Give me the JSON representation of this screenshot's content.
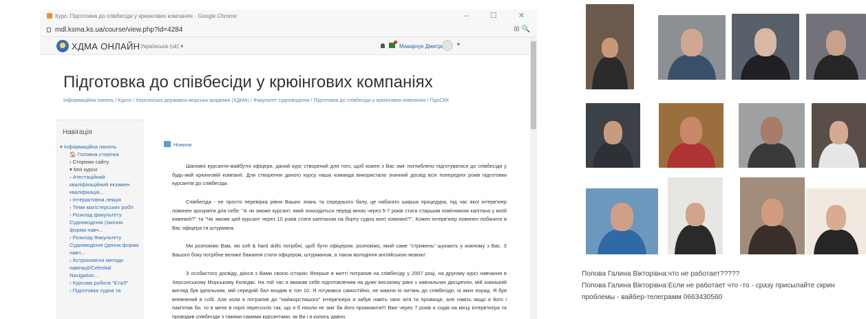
{
  "browser": {
    "window_title": "Курс: Підготовка до співбесіди у крюінгових компаніях - Google Chrome",
    "url": "mdl.ksma.ks.ua/course/view.php?id=4284",
    "window_controls": "–  ☐  ✕",
    "url_right_icons": "⊞  🔍"
  },
  "site": {
    "name": "ХДМА ОНЛАЙН",
    "language": "Українська (uk) ▾",
    "user": "Макарчук Дмитро",
    "user_menu": "▾"
  },
  "page": {
    "title": "Підготовка до співбесіди у крюінгових компаніях",
    "breadcrumb": "Інформаційна панель / Курси / Херсонська державна морська академія (ХДМА) / Факультет судноводіння / Підготовка до співбесіди у крюінгових компаніях / ПдоСКК"
  },
  "sidebar": {
    "heading": "Навігація",
    "items": [
      {
        "label": "▾ Інформаційна панель",
        "cls": ""
      },
      {
        "label": "🏠 Головна сторінка",
        "cls": "sub"
      },
      {
        "label": "› Сторінки сайту",
        "cls": "sub dark"
      },
      {
        "label": "▾ Мої курси",
        "cls": "sub dark"
      },
      {
        "label": "› Атестаційний",
        "cls": "sub"
      },
      {
        "label": "кваліфікаційний екзамен",
        "cls": "sub"
      },
      {
        "label": "кваліфікація...",
        "cls": "sub"
      },
      {
        "label": "› Інтерактивна лекція",
        "cls": "sub"
      },
      {
        "label": "› Теми магістерських робіт",
        "cls": "sub"
      },
      {
        "label": "› Розклад факультету",
        "cls": "sub"
      },
      {
        "label": "Судноводіння (заочна",
        "cls": "sub"
      },
      {
        "label": "форма навч...",
        "cls": "sub"
      },
      {
        "label": "› Розклад Факультету",
        "cls": "sub"
      },
      {
        "label": "Судноводіння (денна форма",
        "cls": "sub"
      },
      {
        "label": "навч...",
        "cls": "sub"
      },
      {
        "label": "› Астрономічні методи",
        "cls": "sub"
      },
      {
        "label": "навігації/Celestial",
        "cls": "sub"
      },
      {
        "label": "Navigation...",
        "cls": "sub"
      },
      {
        "label": "› Курсова робота \"ЄтаЛ\"",
        "cls": "sub"
      },
      {
        "label": "› Підготовка судна та",
        "cls": "sub"
      }
    ]
  },
  "content": {
    "news_label": "Новини",
    "paragraphs": [
      "Шановні курсанти-майбутні офіцери, даний курс створений для того, щоб кожен з Вас зміг поглиблено підготуватися до співбесіди у будь-якій крюінговій компанії. Для створення даного курсу наша команда використала значний досвід всіх попередніх років підготовки курсантів до співбесіди.",
      "Співбесіда - не просто перевірка рівня Ваших знань та середнього балу, це набагато ширша процедура, під час якої інтерв'юер повинен зрозуміти для себе: \"А чи зможе курсант, який знаходиться переді мною через 5-7 років стати старшим помічником капітана у моїй компанії?\" та \"Чи зможе цей курсант через 10 років стати капітаном на борту судна моєї компанії?\". Кожен інтерв'юер повинен побачити в Вас офіцера та штурмана.",
      "Ми розповімо Вам, які soft & hard skills потрібні, щоб бути офіцером, розповімо, який саме \"стрижень\" шукають у кожному з Вас. З Вашого боку потрібне велике бажання стати офіцером, штурманом, а також володіння англійською мовою!",
      "З особистого досвіду, діюся з Вами своєю історію: Вперше в житті потрапив на співбесіду у 2007 році, на другому курсі навчання в Херсонському Морському Коледжі. На той час я вважав себе підготовленим на дуже високому рівні з навчальних дисциплін, мій зовнішній вигляд був ідеальним, мій середній бал входив в топ 10. Я готувався самостійно, не маючи ні питань до співбесіди, ні яких порад. Я був впевнений в собі. Але коли я потрапив до \"найжорсткішого\" інтерв'юера я забув навіть своє ім'я та прізвище, але навіть якщо я його і пам'ятав би, то в мене в горлі пересохло так, що я б ніколи не зміг би його промовити!!! Вже через 7 років я сидів на місці інтерв'юера та проводив співбесіди з такими самими курсантами, як Ви і я колись давно."
    ]
  },
  "video_tiles": [
    {
      "bg": "#6b5a4c",
      "skin": "#c99878",
      "shirt": "#2b2b2b"
    },
    {
      "bg": "#8c8f93",
      "skin": "#d2a791",
      "shirt": "#39506b"
    },
    {
      "bg": "#58606a",
      "skin": "#d9b9a3",
      "shirt": "#1f1f24"
    },
    {
      "bg": "#71727a",
      "skin": "#c9a089",
      "shirt": "#262626"
    },
    {
      "bg": "#3c4148",
      "skin": "#c89b80",
      "shirt": "#2d3135"
    },
    {
      "bg": "#9b6f3d",
      "skin": "#c8896a",
      "shirt": "#b03333"
    },
    {
      "bg": "#9ea0a2",
      "skin": "#a77c6a",
      "shirt": "#3a3a3a"
    },
    {
      "bg": "#5a4f48",
      "skin": "#d6aa92",
      "shirt": "#e6e6e6"
    },
    {
      "bg": "#6d98bd",
      "skin": "#cf9f87",
      "shirt": "#2f6aa6"
    },
    {
      "bg": "#e8e6e2",
      "skin": "#d1a48c",
      "shirt": "#2a2a2a"
    },
    {
      "bg": "#a28c7c",
      "skin": "#d49b7e",
      "shirt": "#3a2e2a"
    },
    {
      "bg": "#efe9e0",
      "skin": "#d8ab93",
      "shirt": "#262626"
    }
  ],
  "chat": {
    "messages": [
      "Попова Галина Вікторівна:что не работает?????",
      "Попова Галина Вікторівна:Если не работает что -то - сразу присылайте скрин проблемы - вайбер-телеграмм 0663430560"
    ]
  }
}
